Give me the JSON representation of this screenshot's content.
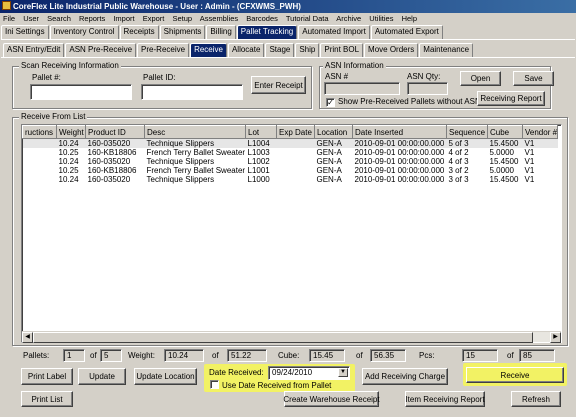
{
  "window": {
    "title": "CoreFlex Lite Industrial Public Warehouse - User : Admin - (CFXWMS_PWH)"
  },
  "menu": [
    "File",
    "User",
    "Search",
    "Reports",
    "Import",
    "Export",
    "Setup",
    "Assemblies",
    "Barcodes",
    "Tutorial Data",
    "Archive",
    "Utilities",
    "Help"
  ],
  "main_tabs": [
    "Ini Settings",
    "Inventory Control",
    "Receipts",
    "Shipments",
    "Billing",
    "Pallet Tracking",
    "Automated Import",
    "Automated Export"
  ],
  "main_tabs_active": "Pallet Tracking",
  "sub_tabs": [
    "ASN Entry/Edit",
    "ASN Pre-Receive",
    "Pre-Receive",
    "Receive",
    "Allocate",
    "Stage",
    "Ship",
    "Print BOL",
    "Move Orders",
    "Maintenance"
  ],
  "sub_tabs_active": "Receive",
  "scan": {
    "title": "Scan Receiving Information",
    "pallet_num_label": "Pallet #:",
    "pallet_num_value": "",
    "pallet_id_label": "Pallet ID:",
    "pallet_id_value": "",
    "enter_receipt": "Enter Receipt"
  },
  "asn": {
    "title": "ASN Information",
    "asn_num_label": "ASN #",
    "asn_num_value": "",
    "asn_qty_label": "ASN Qty:",
    "asn_qty_value": "",
    "open": "Open",
    "save": "Save",
    "receiving_report": "Receiving Report",
    "show_pre_received_label": "Show Pre-Received Pallets without ASN",
    "show_pre_received_checked": true
  },
  "list": {
    "title": "Receive From List",
    "columns": [
      "ructions",
      "Weight",
      "Product ID",
      "Desc",
      "Lot",
      "Exp Date",
      "Location",
      "Date Inserted",
      "Sequence",
      "Cube",
      "Vendor #"
    ],
    "rows": [
      [
        "",
        "10.24",
        "160-035020",
        "Technique Slippers",
        "L1004",
        "",
        "GEN-A",
        "2010-09-01 00:00:00.000",
        "5 of 3",
        "15.4500",
        "V1"
      ],
      [
        "",
        "10.25",
        "160-KB18806",
        "French Terry Ballet Sweater",
        "L1003",
        "",
        "GEN-A",
        "2010-09-01 00:00:00.000",
        "4 of 2",
        "5.0000",
        "V1"
      ],
      [
        "",
        "10.24",
        "160-035020",
        "Technique Slippers",
        "L1002",
        "",
        "GEN-A",
        "2010-09-01 00:00:00.000",
        "4 of 3",
        "15.4500",
        "V1"
      ],
      [
        "",
        "10.25",
        "160-KB18806",
        "French Terry Ballet Sweater",
        "L1001",
        "",
        "GEN-A",
        "2010-09-01 00:00:00.000",
        "3 of 2",
        "5.0000",
        "V1"
      ],
      [
        "",
        "10.24",
        "160-035020",
        "Technique Slippers",
        "L1000",
        "",
        "GEN-A",
        "2010-09-01 00:00:00.000",
        "3 of 3",
        "15.4500",
        "V1"
      ]
    ]
  },
  "totals": {
    "pallets_label": "Pallets:",
    "pallets_value": "1",
    "pallets_of_label": "of",
    "pallets_of_value": "5",
    "weight_label": "Weight:",
    "weight_value": "10.24",
    "weight_of_label": "of",
    "weight_of_value": "51.22",
    "cube_label": "Cube:",
    "cube_value": "15.45",
    "cube_of_label": "of",
    "cube_of_value": "56.35",
    "pcs_label": "Pcs:",
    "pcs_value": "15",
    "pcs_of_label": "of",
    "pcs_of_value": "85"
  },
  "actions": {
    "print_label": "Print Label",
    "update": "Update",
    "update_location": "Update Location",
    "date_received_label": "Date Received:",
    "date_received_value": "09/24/2010",
    "use_date_label": "Use Date Received from Pallet",
    "use_date_checked": false,
    "add_receiving_charge": "Add Receiving Charge",
    "receive": "Receive",
    "print_list": "Print List",
    "create_warehouse_receipt": "Create Warehouse Receipt",
    "item_receiving_report": "Item Receiving Report",
    "refresh": "Refresh"
  },
  "colors": {
    "title_bar": "#0a246a",
    "highlight": "#f2f264",
    "active_tab": "#0a246a"
  }
}
